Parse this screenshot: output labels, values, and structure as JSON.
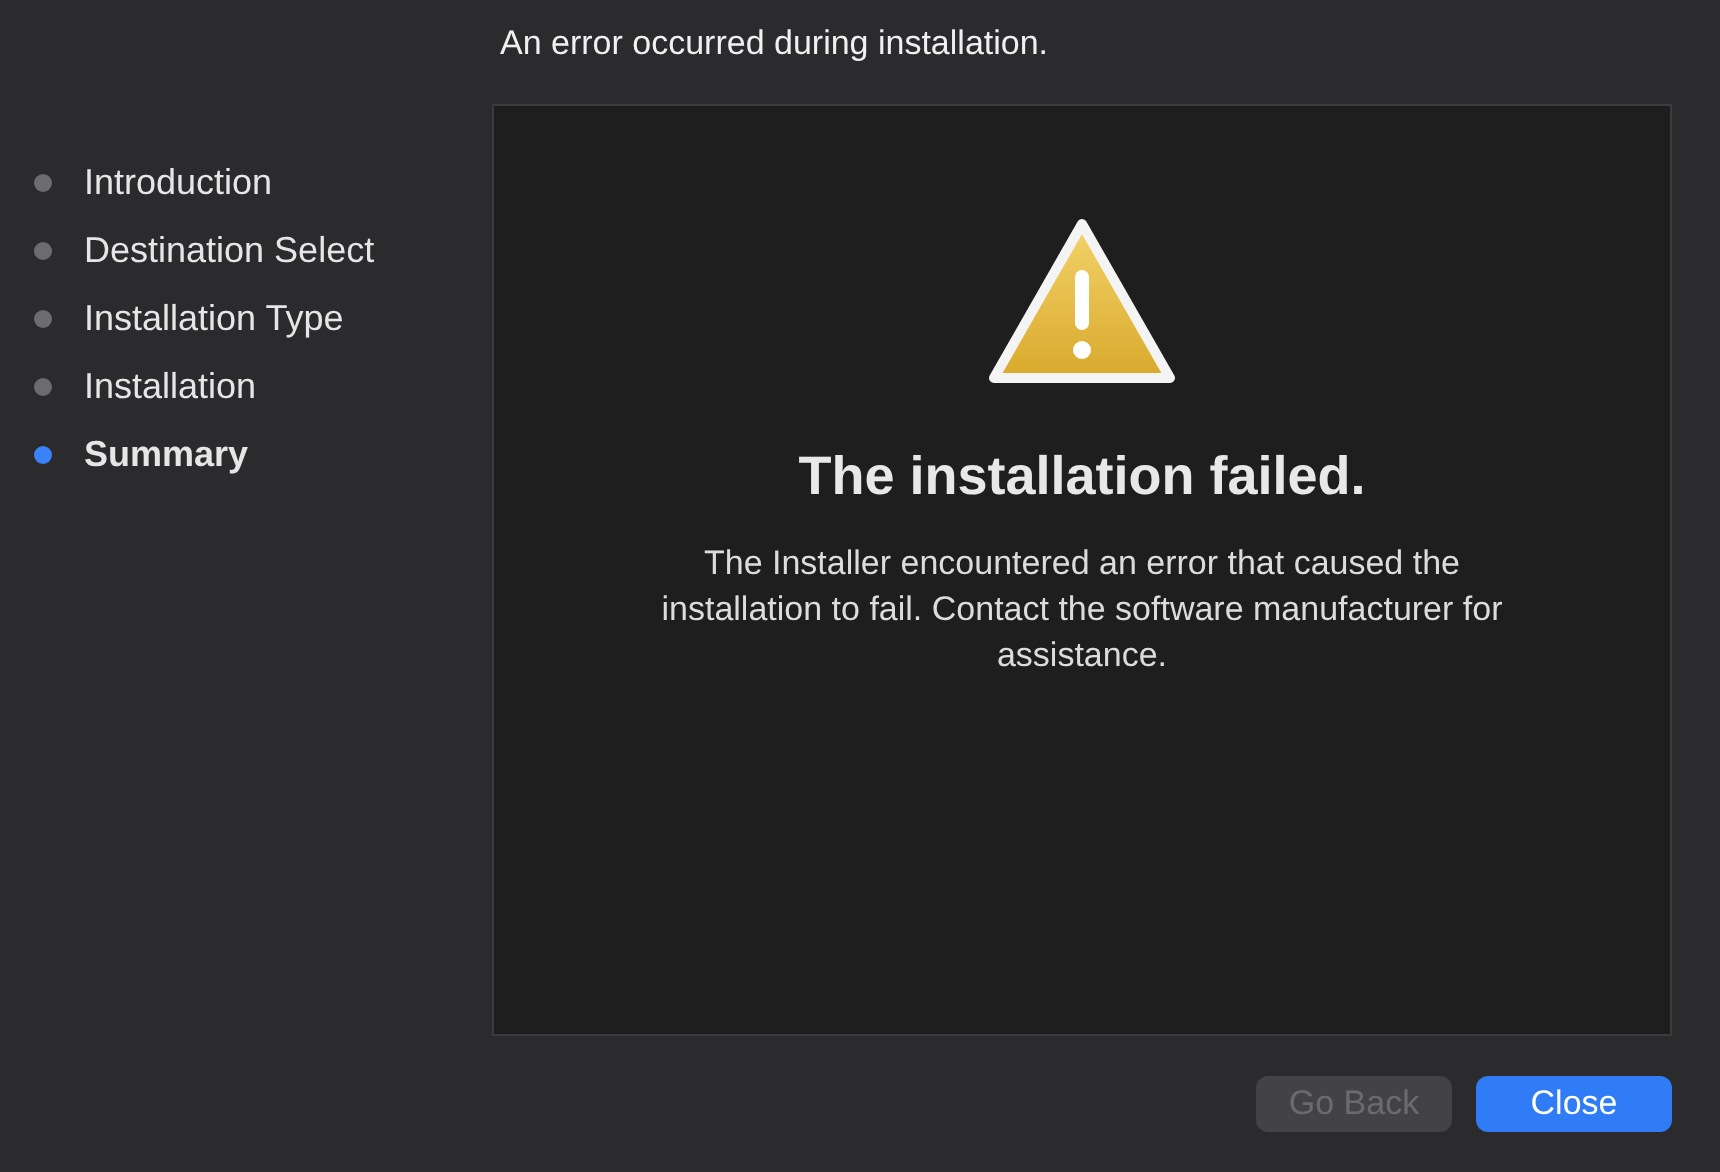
{
  "header": {
    "title": "An error occurred during installation."
  },
  "sidebar": {
    "items": [
      {
        "label": "Introduction",
        "selected": false
      },
      {
        "label": "Destination Select",
        "selected": false
      },
      {
        "label": "Installation Type",
        "selected": false
      },
      {
        "label": "Installation",
        "selected": false
      },
      {
        "label": "Summary",
        "selected": true
      }
    ]
  },
  "panel": {
    "title": "The installation failed.",
    "message": "The Installer encountered an error that caused the installation to fail. Contact the software manufacturer for assistance."
  },
  "buttons": [
    {
      "label": "Go Back",
      "kind": "secondary",
      "disabled": true
    },
    {
      "label": "Close",
      "kind": "primary",
      "disabled": false
    }
  ]
}
